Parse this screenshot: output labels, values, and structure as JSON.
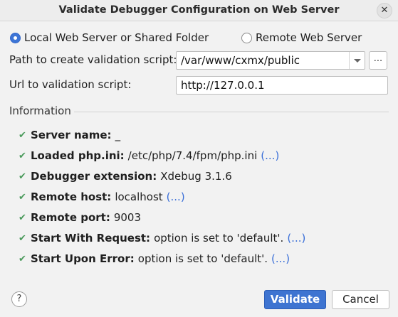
{
  "window": {
    "title": "Validate Debugger Configuration on Web Server"
  },
  "mode": {
    "local_label": "Local Web Server or Shared Folder",
    "remote_label": "Remote Web Server",
    "selected": "local"
  },
  "path": {
    "label": "Path to create validation script:",
    "value": "/var/www/cxmx/public",
    "browse_label": "..."
  },
  "url": {
    "label": "Url to validation script:",
    "value": "http://127.0.0.1"
  },
  "information": {
    "title": "Information",
    "items": [
      {
        "key": "Server name:",
        "value": "_",
        "link": ""
      },
      {
        "key": "Loaded php.ini:",
        "value": "/etc/php/7.4/fpm/php.ini",
        "link": "(...)"
      },
      {
        "key": "Debugger extension:",
        "value": "Xdebug 3.1.6",
        "link": ""
      },
      {
        "key": "Remote host:",
        "value": "localhost",
        "link": "(...)"
      },
      {
        "key": "Remote port:",
        "value": "9003",
        "link": ""
      },
      {
        "key": "Start With Request:",
        "value": "option is set to 'default'.",
        "link": "(...)"
      },
      {
        "key": "Start Upon Error:",
        "value": "option is set to 'default'.",
        "link": "(...)"
      }
    ]
  },
  "buttons": {
    "help": "?",
    "validate": "Validate",
    "cancel": "Cancel"
  },
  "icons": {
    "check": "check-icon",
    "close": "close-icon",
    "help": "help-icon",
    "dropdown": "chevron-down-icon"
  },
  "colors": {
    "accent": "#3e74d1",
    "check": "#4a9a5b",
    "link": "#3a6fd8"
  }
}
